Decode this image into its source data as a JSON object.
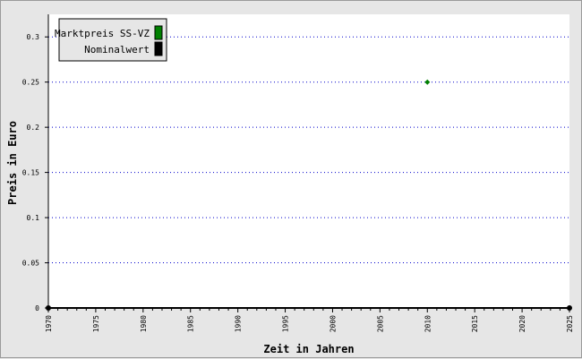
{
  "chart_data": {
    "type": "scatter",
    "title": "",
    "xlabel": "Zeit in Jahren",
    "ylabel": "Preis in Euro",
    "xlim": [
      1970,
      2025
    ],
    "ylim": [
      0,
      0.325
    ],
    "x_ticks": [
      1970,
      1975,
      1980,
      1985,
      1990,
      1995,
      2000,
      2005,
      2010,
      2015,
      2020,
      2025
    ],
    "x_tick_labels": [
      "1970",
      "1975",
      "1980",
      "1985",
      "1990",
      "1995",
      "2000",
      "2005",
      "2010",
      "2015",
      "2020",
      "2025"
    ],
    "y_ticks": [
      0,
      0.05,
      0.1,
      0.15,
      0.2,
      0.25,
      0.3
    ],
    "y_tick_labels": [
      "0",
      "0.05",
      "0.1",
      "0.15",
      "0.2",
      "0.25",
      "0.3"
    ],
    "grid": "horizontal dotted",
    "legend_position": "top-left",
    "series": [
      {
        "name": "Marktpreis SS-VZ",
        "color": "#008000",
        "marker": "diamond",
        "x": [
          2010
        ],
        "y": [
          0.25
        ]
      },
      {
        "name": "Nominalwert",
        "color": "#000000",
        "marker": "circle",
        "x": [
          1970,
          2025
        ],
        "y": [
          0,
          0
        ]
      }
    ]
  }
}
